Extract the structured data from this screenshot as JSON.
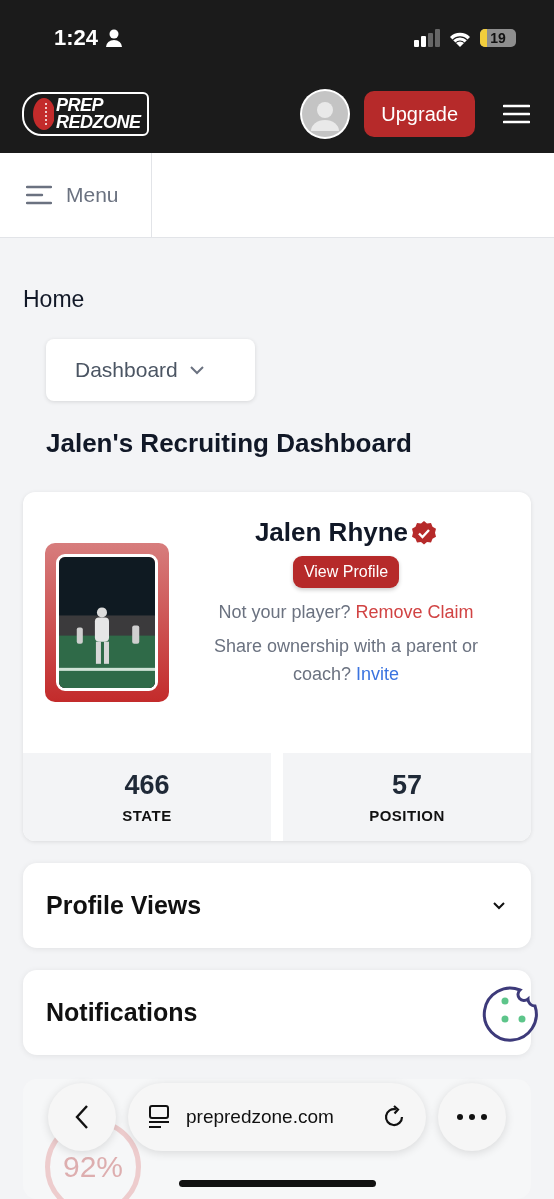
{
  "status_bar": {
    "time": "1:24",
    "battery": "19"
  },
  "header": {
    "logo_top": "PREP",
    "logo_bottom": "REDZONE",
    "upgrade": "Upgrade"
  },
  "menu_bar": {
    "label": "Menu"
  },
  "breadcrumb": "Home",
  "dropdown": {
    "value": "Dashboard"
  },
  "title": "Jalen's Recruiting Dashboard",
  "player": {
    "name": "Jalen Rhyne",
    "verified": true,
    "view_profile": "View Profile",
    "claim_prompt": "Not your player?",
    "claim_link": "Remove Claim",
    "share_prompt": "Share ownership with a parent or coach?",
    "share_link": "Invite"
  },
  "rankings": [
    {
      "value": "466",
      "label": "STATE"
    },
    {
      "value": "57",
      "label": "POSITION"
    }
  ],
  "sections": [
    {
      "title": "Profile Views",
      "kind": "collapsible"
    },
    {
      "title": "Notifications",
      "kind": "plain"
    }
  ],
  "progress": {
    "reading": "92%"
  },
  "browser": {
    "url": "prepredzone.com"
  }
}
